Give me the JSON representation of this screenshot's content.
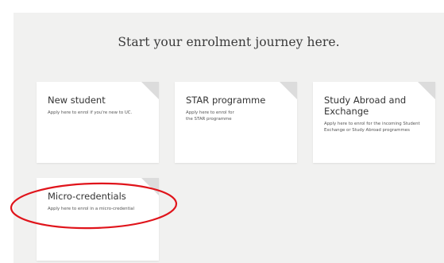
{
  "heading": "Start your enrolment journey here.",
  "cards": [
    {
      "title": "New student",
      "description": "Apply here to enrol if you're new to UC."
    },
    {
      "title": "STAR programme",
      "description": "Apply here to enrol for the STAR programme"
    },
    {
      "title": "Study Abroad and Exchange",
      "description": "Apply here to enrol for the incoming Student Exchange or Study Abroad programmes"
    },
    {
      "title": "Micro-credentials",
      "description": "Apply here to enrol in a micro-credential"
    }
  ],
  "colors": {
    "panel_background": "#f1f1f0",
    "card_background": "#ffffff",
    "fold_corner": "#dcdcdc",
    "annotation_ellipse": "#e0141b"
  },
  "icons": {
    "card_corner": "external-link-icon"
  }
}
